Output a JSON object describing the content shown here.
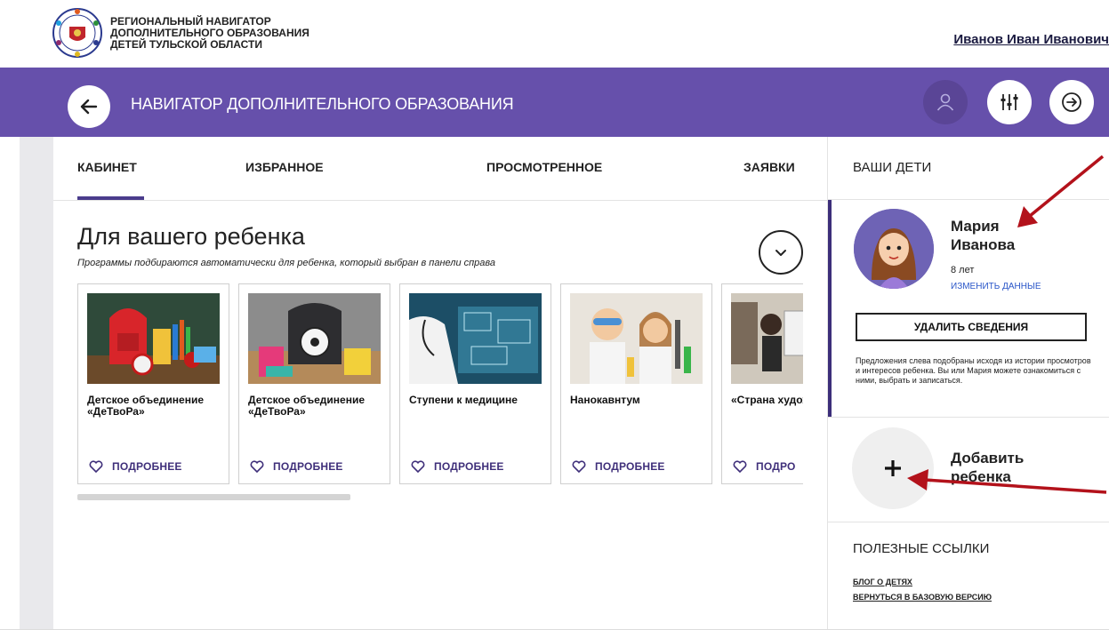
{
  "header": {
    "org_lines": [
      "РЕГИОНАЛЬНЫЙ НАВИГАТОР",
      "ДОПОЛНИТЕЛЬНОГО ОБРАЗОВАНИЯ",
      "ДЕТЕЙ ТУЛЬСКОЙ ОБЛАСТИ"
    ],
    "user_name": "Иванов Иван Иванович"
  },
  "navbar": {
    "title": "НАВИГАТОР ДОПОЛНИТЕЛЬНОГО ОБРАЗОВАНИЯ",
    "color": "#6650ab"
  },
  "tabs": [
    {
      "label": "КАБИНЕТ",
      "active": true
    },
    {
      "label": "ИЗБРАННОЕ",
      "active": false
    },
    {
      "label": "ПРОСМОТРЕННОЕ",
      "active": false
    },
    {
      "label": "ЗАЯВКИ",
      "active": false
    }
  ],
  "main": {
    "title": "Для вашего ребенка",
    "subtitle": "Программы подбираются автоматически для ребенка, который выбран в панели справа",
    "more_label": "ПОДРОБНЕЕ",
    "more_label_cut": "ПОДРО",
    "cards": [
      {
        "title": "Детское объединение «ДеТвоРа»",
        "image": "school-supplies"
      },
      {
        "title": "Детское объединение «ДеТвоРа»",
        "image": "school-backpack"
      },
      {
        "title": "Ступени к медицине",
        "image": "medicine"
      },
      {
        "title": "Нанокавнтум",
        "image": "kids-lab"
      },
      {
        "title": "«Страна художнико",
        "image": "art-class"
      }
    ]
  },
  "panel": {
    "heading": "ВАШИ ДЕТИ",
    "child": {
      "name": "Мария Иванова",
      "age": "8 лет",
      "edit_label": "ИЗМЕНИТЬ ДАННЫЕ",
      "delete_label": "УДАЛИТЬ СВЕДЕНИЯ",
      "note": "Предложения слева подобраны исходя из истории просмотров и интересов ребенка. Вы или Мария можете ознакомиться с ними, выбрать и записаться."
    },
    "add_child_label": "Добавить ребенка",
    "links_heading": "ПОЛЕЗНЫЕ ССЫЛКИ",
    "links": [
      "БЛОГ О ДЕТЯХ",
      "ВЕРНУТЬСЯ В БАЗОВУЮ ВЕРСИЮ"
    ]
  },
  "colors": {
    "accent_dark": "#3c2e7a",
    "annotation_arrow": "#b3121b"
  }
}
